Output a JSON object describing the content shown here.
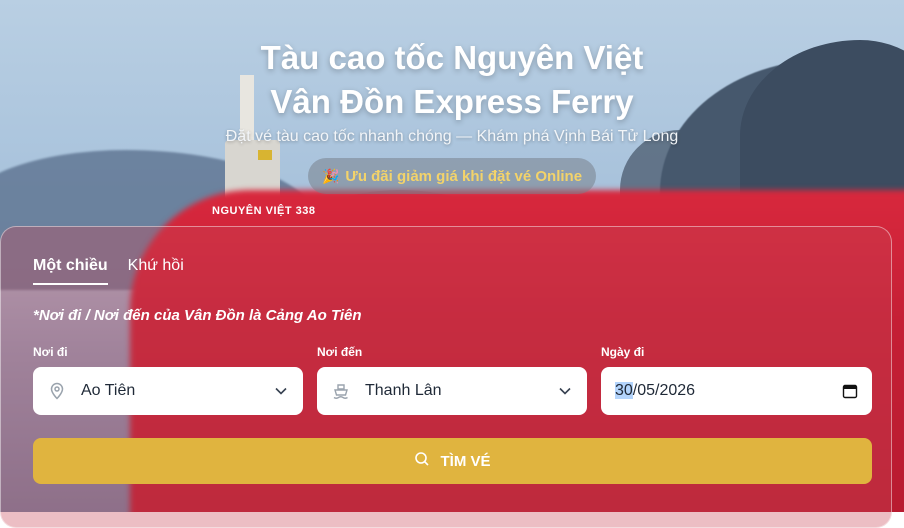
{
  "hero": {
    "title_line1": "Tàu cao tốc Nguyên Việt",
    "title_line2": "Vân Đồn Express Ferry",
    "subtitle": "Đặt vé tàu cao tốc nhanh chóng — Khám phá Vịnh Bái Tử Long",
    "promo_emoji": "🎉",
    "promo_text": "Ưu đãi giảm giá khi đặt vé Online",
    "ship_name": "NGUYÊN VIỆT 338"
  },
  "booking": {
    "tabs": [
      {
        "label": "Một chiều",
        "active": true
      },
      {
        "label": "Khứ hồi",
        "active": false
      }
    ],
    "note": "*Nơi đi / Nơi đến của Vân Đồn là Cảng Ao Tiên",
    "from": {
      "label": "Nơi đi",
      "value": "Ao Tiên",
      "icon": "location-pin-icon"
    },
    "to": {
      "label": "Nơi đến",
      "value": "Thanh Lân",
      "icon": "ship-icon"
    },
    "date": {
      "label": "Ngày đi",
      "day": "30",
      "rest": "/05/2026",
      "icon": "calendar-icon"
    },
    "search_label": "TÌM VÉ"
  },
  "colors": {
    "accent": "#e0b43f",
    "promo_text": "#f3d36a"
  }
}
